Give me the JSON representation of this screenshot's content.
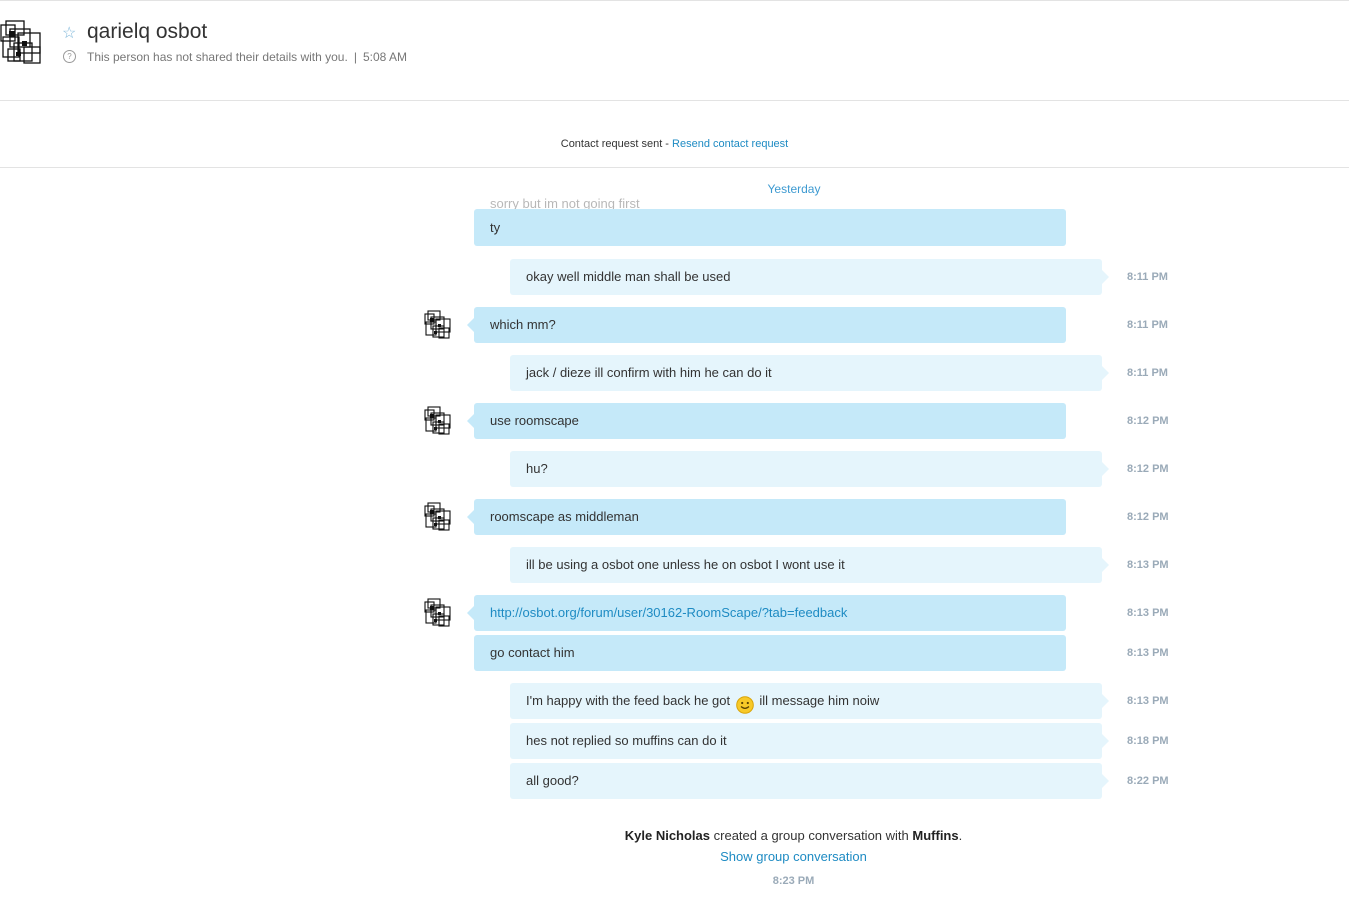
{
  "contact": {
    "name": "qarielq osbot",
    "status_text": "This person has not shared their details with you.",
    "separator": "|",
    "local_time": "5:08 AM"
  },
  "contact_request": {
    "status": "Contact request sent -",
    "resend_label": "Resend contact request"
  },
  "day_label": "Yesterday",
  "faded_message": {
    "text": "sorry but im not going first"
  },
  "messages": [
    {
      "text": "ty",
      "time": ""
    },
    {
      "text": "okay well middle man shall be used",
      "time": "8:11 PM"
    },
    {
      "text": "which mm?",
      "time": "8:11 PM"
    },
    {
      "text": "jack / dieze ill confirm with him he can do it",
      "time": "8:11 PM"
    },
    {
      "text": "use roomscape",
      "time": "8:12 PM"
    },
    {
      "text": "hu?",
      "time": "8:12 PM"
    },
    {
      "text": "roomscape as middleman",
      "time": "8:12 PM"
    },
    {
      "text": "ill be using a osbot one unless he on osbot I wont use it",
      "time": "8:13 PM"
    },
    {
      "text": "http://osbot.org/forum/user/30162-RoomScape/?tab=feedback",
      "time": "8:13 PM"
    },
    {
      "text": "go contact him",
      "time": "8:13 PM"
    },
    {
      "text_before": "I'm happy with the feed back he got",
      "text_after": "ill message him noiw",
      "time": "8:13 PM"
    },
    {
      "text": "hes not replied so muffins can do it",
      "time": "8:18 PM"
    },
    {
      "text": "all good?",
      "time": "8:22 PM"
    }
  ],
  "system_event": {
    "actor": "Kyle Nicholas",
    "action": "created a group conversation with",
    "group": "Muffins",
    "period": ".",
    "link_label": "Show group conversation",
    "time": "8:23 PM"
  },
  "icons": {
    "favorite": "star-outline-icon",
    "info": "question-circle-icon",
    "emoji": "smiley-icon"
  },
  "colors": {
    "incoming_bubble": "#c5e9f9",
    "outgoing_bubble": "#e5f5fc",
    "link": "#1e8bc3",
    "timestamp": "#9aaab8"
  }
}
